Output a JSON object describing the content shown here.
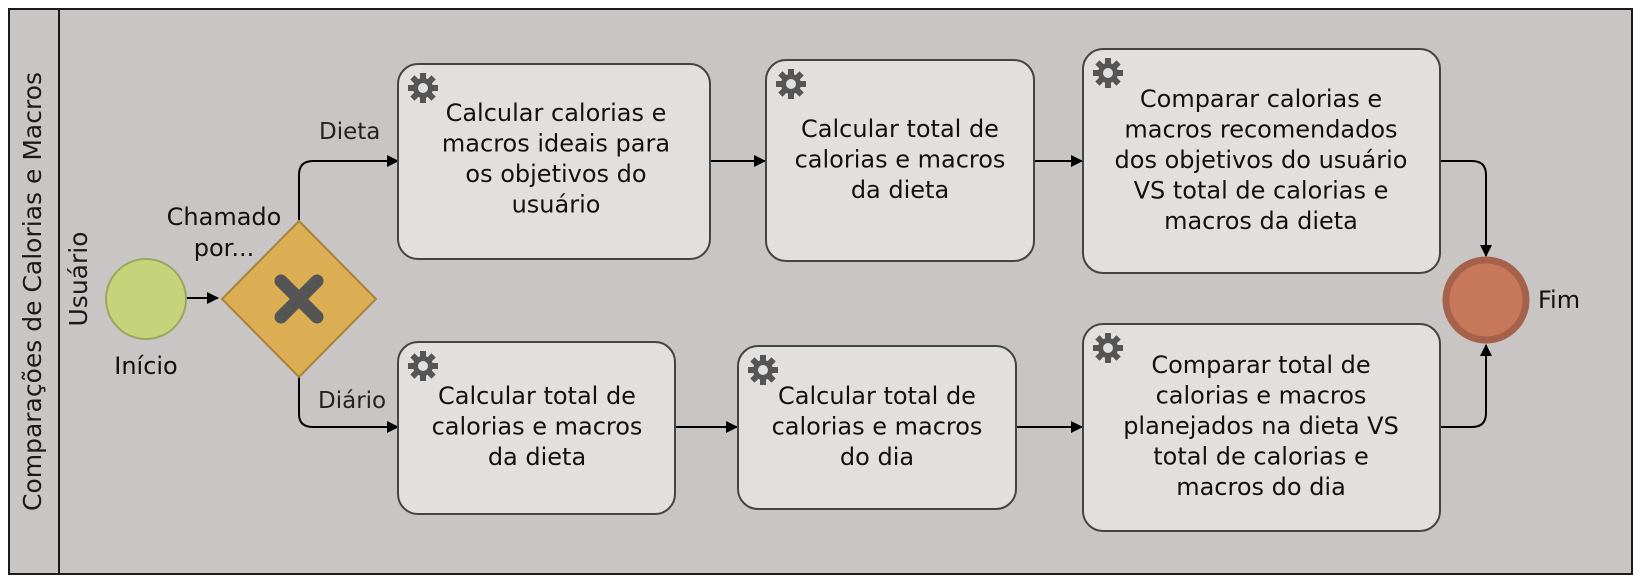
{
  "pool": {
    "title": "Comparações de Calorias e Macros",
    "lane_title": "Usuário"
  },
  "start_event": {
    "label": "Início"
  },
  "gateway": {
    "label_line1": "Chamado",
    "label_line2": "por..."
  },
  "end_event": {
    "label": "Fim"
  },
  "flows": {
    "dieta": "Dieta",
    "diario": "Diário"
  },
  "tasks": {
    "top1": [
      "Calcular calorias e",
      "macros ideais para",
      "os objetivos do",
      "usuário"
    ],
    "top2": [
      "Calcular total de",
      "calorias e macros",
      "da dieta"
    ],
    "top3": [
      "Comparar calorias e",
      "macros recomendados",
      "dos objetivos do usuário",
      "VS total de calorias e",
      "macros da dieta"
    ],
    "bot1": [
      "Calcular total de",
      "calorias e macros",
      "da dieta"
    ],
    "bot2": [
      "Calcular total de",
      "calorias e macros",
      "do dia"
    ],
    "bot3": [
      "Comparar total de",
      "calorias e macros",
      "planejados na dieta VS",
      "total de calorias e",
      "macros do dia"
    ]
  },
  "colors": {
    "pool_fill": "#c9c5c4",
    "task_fill": "#e1e0df",
    "start_fill": "#c5d47b",
    "gateway_fill": "#dcae53",
    "end_fill": "#c8785a",
    "end_stroke": "#a6614a"
  }
}
